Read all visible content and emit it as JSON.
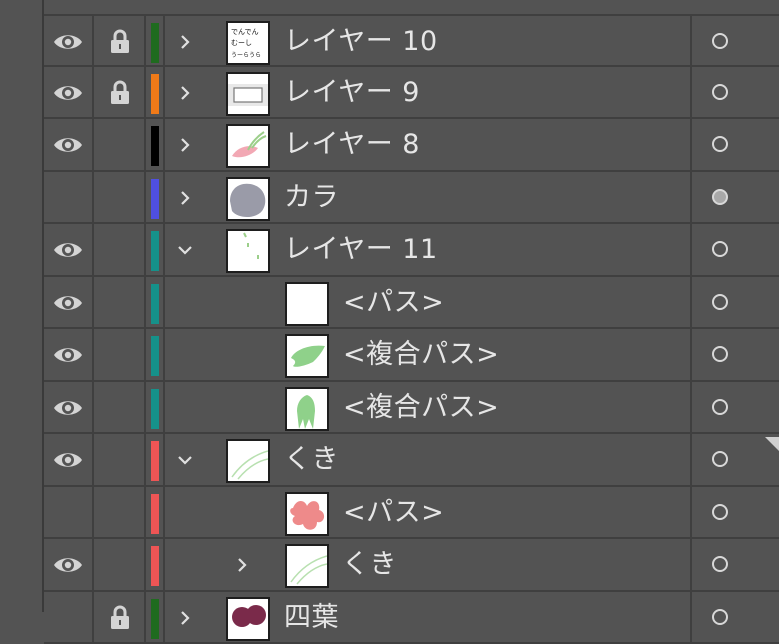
{
  "layers": [
    {
      "name": "レイヤー 10",
      "visible": true,
      "locked": true,
      "color": "#1f6b1f",
      "expand": "collapsed",
      "indent": 0,
      "thumb": "text",
      "target": "empty"
    },
    {
      "name": "レイヤー 9",
      "visible": true,
      "locked": true,
      "color": "#f07a18",
      "expand": "collapsed",
      "indent": 0,
      "thumb": "rects",
      "target": "empty"
    },
    {
      "name": "レイヤー 8",
      "visible": true,
      "locked": false,
      "color": "#000000",
      "expand": "collapsed",
      "indent": 0,
      "thumb": "pink-flower",
      "target": "empty"
    },
    {
      "name": "カラ",
      "visible": false,
      "locked": false,
      "color": "#4f4fe0",
      "expand": "collapsed",
      "indent": 0,
      "thumb": "gray-blob",
      "target": "filled"
    },
    {
      "name": "レイヤー 11",
      "visible": true,
      "locked": false,
      "color": "#16918a",
      "expand": "expanded",
      "indent": 0,
      "thumb": "sprigs",
      "target": "empty"
    },
    {
      "name": "<パス>",
      "visible": true,
      "locked": false,
      "color": "#16918a",
      "expand": "none",
      "indent": 1,
      "thumb": "blank",
      "target": "empty"
    },
    {
      "name": "<複合パス>",
      "visible": true,
      "locked": false,
      "color": "#16918a",
      "expand": "none",
      "indent": 1,
      "thumb": "green-leaf",
      "target": "empty"
    },
    {
      "name": "<複合パス>",
      "visible": true,
      "locked": false,
      "color": "#16918a",
      "expand": "none",
      "indent": 1,
      "thumb": "green-stem",
      "target": "empty"
    },
    {
      "name": "くき",
      "visible": true,
      "locked": false,
      "color": "#ee5555",
      "expand": "expanded",
      "indent": 0,
      "thumb": "lines",
      "target": "empty"
    },
    {
      "name": "<パス>",
      "visible": false,
      "locked": false,
      "color": "#ee5555",
      "expand": "none",
      "indent": 1,
      "thumb": "pink-blob",
      "target": "empty"
    },
    {
      "name": "くき",
      "visible": true,
      "locked": false,
      "color": "#ee5555",
      "expand": "collapsed",
      "indent": 1,
      "thumb": "lines",
      "target": "empty"
    },
    {
      "name": "四葉",
      "visible": false,
      "locked": true,
      "color": "#1f6b1f",
      "expand": "collapsed",
      "indent": 0,
      "thumb": "purple",
      "target": "empty"
    }
  ],
  "thumb_text": [
    "でんでん",
    "むーし",
    "うーらうら"
  ]
}
